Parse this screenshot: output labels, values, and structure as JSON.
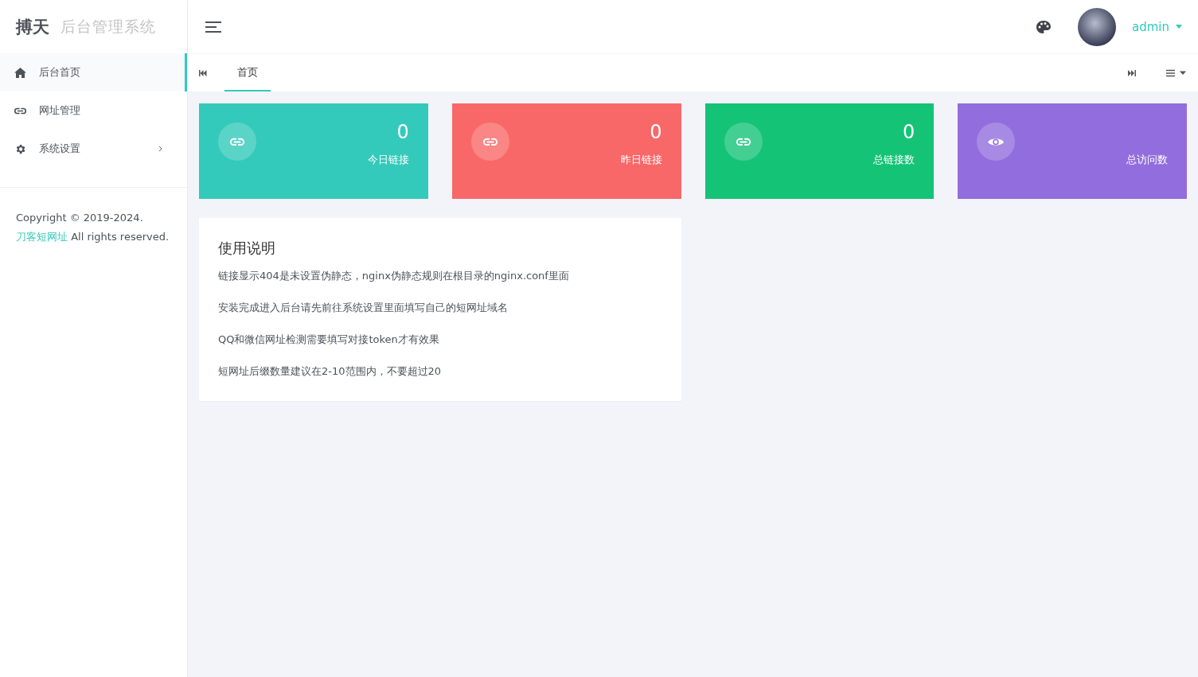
{
  "brand": {
    "name": "搏天",
    "subtitle": "后台管理系统"
  },
  "sidebar": {
    "items": [
      {
        "label": "后台首页",
        "selected": true,
        "submenu": false
      },
      {
        "label": "网址管理",
        "selected": false,
        "submenu": false
      },
      {
        "label": "系统设置",
        "selected": false,
        "submenu": true
      }
    ],
    "footer": {
      "before": "Copyright © 2019-2024.",
      "link": "刀客短网址",
      "after": "All rights reserved."
    }
  },
  "header": {
    "user": "admin"
  },
  "tabs": [
    {
      "label": "首页",
      "selected": true
    }
  ],
  "stats": [
    {
      "color": "#33cabb",
      "value": "0",
      "label": "今日链接"
    },
    {
      "color": "#f96868",
      "value": "0",
      "label": "昨日链接"
    },
    {
      "color": "#15c377",
      "value": "0",
      "label": "总链接数"
    },
    {
      "color": "#926dde",
      "label": "总访问数"
    }
  ],
  "notes": {
    "title": "使用说明",
    "lines": [
      "链接显示404是未设置伪静态，nginx伪静态规则在根目录的nginx.conf里面",
      "安装完成进入后台请先前往系统设置里面填写自己的短网址域名",
      "QQ和微信网址检测需要填写对接token才有效果",
      "短网址后缀数量建议在2-10范围内，不要超过20"
    ]
  }
}
